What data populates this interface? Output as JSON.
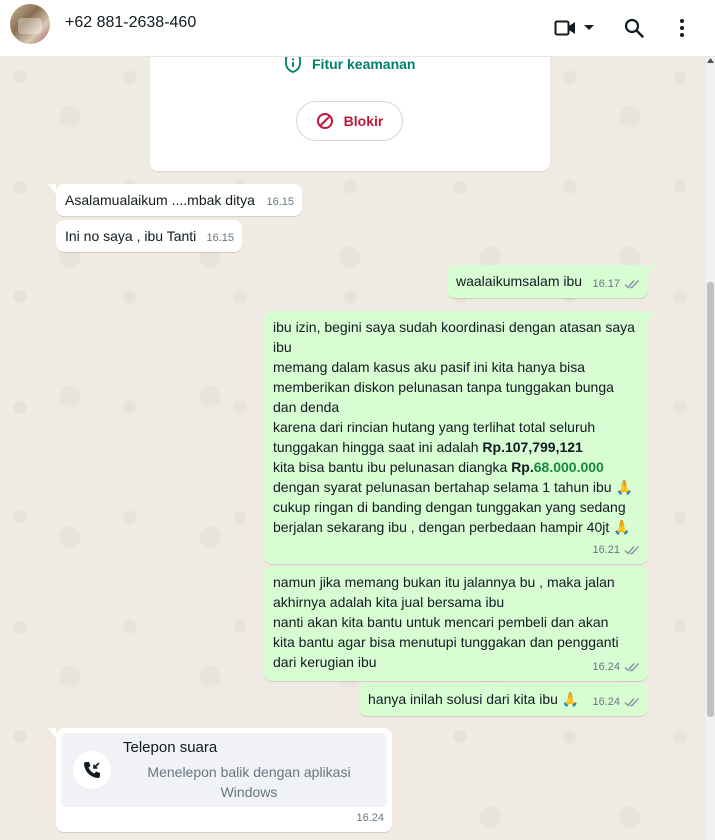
{
  "header": {
    "title": "+62 881-2638-460",
    "icons": [
      "avatar",
      "video-call-icon",
      "chevron-down-icon",
      "search-icon",
      "more-vertical-icon"
    ]
  },
  "security": {
    "link_label": "Fitur keamanan",
    "block_label": "Blokir",
    "accent_color": "#008069",
    "block_color": "#c1163a"
  },
  "messages": [
    {
      "dir": "in",
      "text": "Asalamualaikum ....mbak ditya",
      "time": "16.15"
    },
    {
      "dir": "in",
      "text": "Ini no saya , ibu Tanti",
      "time": "16.15"
    },
    {
      "dir": "out",
      "text": "waalaikumsalam ibu",
      "time": "16.17"
    },
    {
      "dir": "out",
      "time": "16.21",
      "lines": [
        "ibu izin, begini saya sudah koordinasi dengan atasan saya",
        "ibu",
        "memang dalam kasus aku pasif ini kita hanya bisa",
        "memberikan diskon pelunasan tanpa tunggakan bunga",
        "dan denda",
        "karena dari rincian hutang yang terlihat total seluruh",
        "tunggakan hingga saat ini adalah ",
        "Rp.107,799,121",
        "kita bisa bantu ibu pelunasan diangka ",
        "Rp.",
        "68.000.000",
        "dengan syarat pelunasan bertahap selama 1 tahun ibu 🙏",
        "cukup ringan di banding dengan tunggakan yang sedang",
        "berjalan sekarang ibu , dengan perbedaan hampir 40jt 🙏"
      ]
    },
    {
      "dir": "out",
      "time": "16.24",
      "lines": [
        "namun jika memang bukan itu jalannya bu , maka jalan",
        "akhirnya adalah kita jual bersama ibu",
        "nanti akan kita bantu untuk mencari pembeli dan akan",
        "kita bantu agar bisa menutupi tunggakan dan pengganti",
        "dari kerugian ibu"
      ]
    },
    {
      "dir": "out",
      "text": "hanya inilah solusi dari kita ibu 🙏",
      "time": "16.24"
    },
    {
      "dir": "in",
      "type": "call",
      "title": "Telepon suara",
      "subtitle": "Menelepon balik dengan aplikasi Windows",
      "time": "16.24"
    }
  ],
  "colors": {
    "chat_bg": "#efeae2",
    "incoming_bubble": "#ffffff",
    "outgoing_bubble": "#d9fdd3",
    "read_ticks": "#8696a0",
    "amount_green": "#138a3d"
  }
}
